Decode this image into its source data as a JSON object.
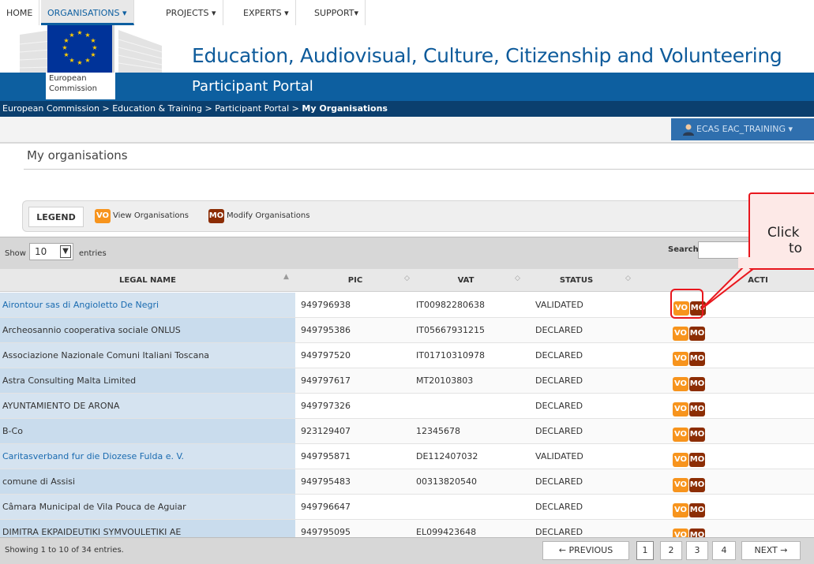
{
  "header": {
    "ec_label_line1": "European",
    "ec_label_line2": "Commission",
    "dg_title": "Education, Audiovisual, Culture, Citizenship and Volunteering",
    "portal_title": "Participant Portal",
    "brand_color": "#0d5fa0"
  },
  "breadcrumb": {
    "items": [
      "European Commission",
      "Education & Training",
      "Participant Portal"
    ],
    "current": "My Organisations"
  },
  "nav": {
    "items": [
      "HOME",
      "ORGANISATIONS ▾",
      "PROJECTS ▾",
      "EXPERTS ▾",
      "SUPPORT▾"
    ],
    "active_index": 1,
    "user": "ECAS EAC_TRAINING ▾"
  },
  "page": {
    "title": "My organisations"
  },
  "legend": {
    "label": "LEGEND",
    "vo_badge": "VO",
    "vo_text": "View Organisations",
    "mo_badge": "MO",
    "mo_text": "Modify Organisations",
    "vo_color": "#f7941d",
    "mo_color": "#8c2d04"
  },
  "table": {
    "show_label": "Show",
    "page_size": "10",
    "entries_label": "entries",
    "search_label": "Search",
    "headers": {
      "legal_name": "LEGAL NAME",
      "pic": "PIC",
      "vat": "VAT",
      "status": "STATUS",
      "actions": "ACTI"
    },
    "rows": [
      {
        "name": "Airontour sas di Angioletto De Negri",
        "pic": "949796938",
        "vat": "IT00982280638",
        "status": "VALIDATED",
        "vo": "VO",
        "mo": "MO"
      },
      {
        "name": "Archeosannio cooperativa sociale ONLUS",
        "pic": "949795386",
        "vat": "IT05667931215",
        "status": "DECLARED",
        "vo": "VO",
        "mo": "MO"
      },
      {
        "name": "Associazione Nazionale Comuni Italiani Toscana",
        "pic": "949797520",
        "vat": "IT01710310978",
        "status": "DECLARED",
        "vo": "VO",
        "mo": "MO"
      },
      {
        "name": "Astra Consulting Malta Limited",
        "pic": "949797617",
        "vat": "MT20103803",
        "status": "DECLARED",
        "vo": "VO",
        "mo": "MO"
      },
      {
        "name": "AYUNTAMIENTO DE ARONA",
        "pic": "949797326",
        "vat": "",
        "status": "DECLARED",
        "vo": "VO",
        "mo": "MO"
      },
      {
        "name": "B-Co",
        "pic": "923129407",
        "vat": "12345678",
        "status": "DECLARED",
        "vo": "VO",
        "mo": "MO"
      },
      {
        "name": "Caritasverband fur die Diozese Fulda e. V.",
        "pic": "949795871",
        "vat": "DE112407032",
        "status": "VALIDATED",
        "vo": "VO",
        "mo": "MO"
      },
      {
        "name": "comune di Assisi",
        "pic": "949795483",
        "vat": "00313820540",
        "status": "DECLARED",
        "vo": "VO",
        "mo": "MO"
      },
      {
        "name": "Câmara Municipal de Vila Pouca de Aguiar",
        "pic": "949796647",
        "vat": "",
        "status": "DECLARED",
        "vo": "VO",
        "mo": "MO"
      },
      {
        "name": "DIMITRA EKPAIDEUTIKI SYMVOULETIKI AE",
        "pic": "949795095",
        "vat": "EL099423648",
        "status": "DECLARED",
        "vo": "VO",
        "mo": "MO"
      }
    ],
    "showing": "Showing 1 to 10 of 34 entries.",
    "pagination": {
      "previous": "← PREVIOUS",
      "pages": [
        "1",
        "2",
        "3",
        "4"
      ],
      "current": "1",
      "next": "NEXT →"
    }
  },
  "callout": {
    "line1": "Click",
    "line2": "to"
  }
}
